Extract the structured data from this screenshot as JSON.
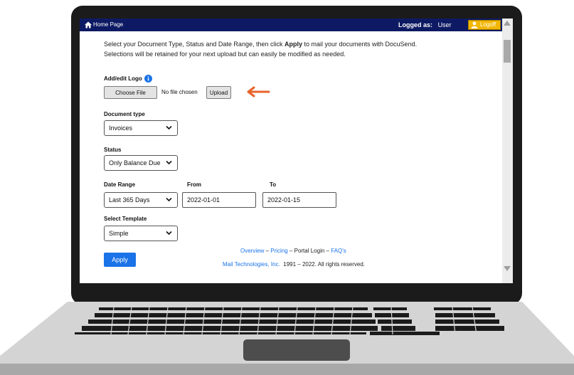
{
  "topbar": {
    "home_label": "Home Page",
    "logged_as_label": "Logged as:",
    "user_name": "User",
    "logoff_label": "Logoff"
  },
  "intro": {
    "line1_before": "Select your Document Type, Status and Date Range, then click ",
    "line1_bold": "Apply",
    "line1_after": " to mail your documents with DocuSend.",
    "line2": "Selections will be retained for your next upload but can easily be modified as needed."
  },
  "logo": {
    "label": "Add/edit Logo",
    "choose_file_label": "Choose File",
    "no_file_text": "No file chosen",
    "upload_label": "Upload"
  },
  "document_type": {
    "label": "Document type",
    "selected": "Invoices"
  },
  "status": {
    "label": "Status",
    "selected": "Only Balance Due"
  },
  "date_range": {
    "label": "Date Range",
    "selected": "Last 365 Days",
    "from_label": "From",
    "from_value": "2022-01-01",
    "to_label": "To",
    "to_value": "2022-01-15"
  },
  "template": {
    "label": "Select Template",
    "selected": "Simple"
  },
  "apply_label": "Apply",
  "footer": {
    "links": [
      "Overview",
      "Pricing",
      "Portal Login",
      "FAQ's"
    ],
    "separator": " – ",
    "company": "Mail Technologies, Inc.",
    "copyright": "1991 – 2022.  All rights reserved."
  },
  "colors": {
    "topbar": "#0d1a63",
    "logoff": "#f2b705",
    "accent": "#1a73e8",
    "arrow": "#e8632a"
  },
  "icons": [
    "home-icon",
    "user-icon",
    "info-icon",
    "chevron-down-icon",
    "arrow-left-icon"
  ]
}
